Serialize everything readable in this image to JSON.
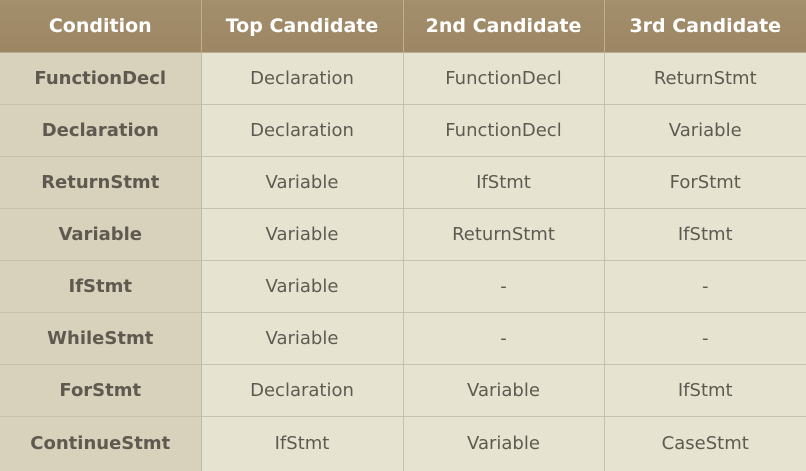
{
  "table": {
    "headers": [
      "Condition",
      "Top Candidate",
      "2nd Candidate",
      "3rd Candidate"
    ],
    "rows": [
      [
        "FunctionDecl",
        "Declaration",
        "FunctionDecl",
        "ReturnStmt"
      ],
      [
        "Declaration",
        "Declaration",
        "FunctionDecl",
        "Variable"
      ],
      [
        "ReturnStmt",
        "Variable",
        "IfStmt",
        "ForStmt"
      ],
      [
        "Variable",
        "Variable",
        "ReturnStmt",
        "IfStmt"
      ],
      [
        "IfStmt",
        "Variable",
        "-",
        "-"
      ],
      [
        "WhileStmt",
        "Variable",
        "-",
        "-"
      ],
      [
        "ForStmt",
        "Declaration",
        "Variable",
        "IfStmt"
      ],
      [
        "ContinueStmt",
        "IfStmt",
        "Variable",
        "CaseStmt"
      ]
    ]
  },
  "colors": {
    "header_bg": "#a48f6d",
    "header_text": "#ffffff",
    "condition_col_bg": "#d8d1bb",
    "cell_bg": "#e7e3d1",
    "cell_text": "#5f5a50"
  }
}
